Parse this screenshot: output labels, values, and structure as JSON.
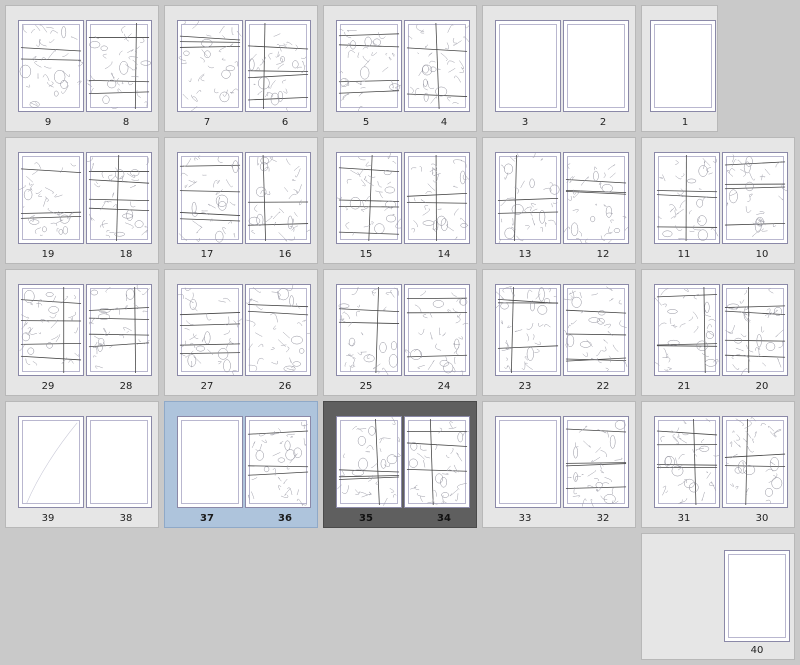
{
  "window": {
    "title": ""
  },
  "spreads": [
    {
      "pages": [
        "9",
        "8"
      ],
      "content": [
        "sketch",
        "sketch"
      ],
      "state": "normal"
    },
    {
      "pages": [
        "7",
        "6"
      ],
      "content": [
        "sketch",
        "sketch"
      ],
      "state": "normal"
    },
    {
      "pages": [
        "5",
        "4"
      ],
      "content": [
        "sketch",
        "sketch"
      ],
      "state": "normal"
    },
    {
      "pages": [
        "3",
        "2"
      ],
      "content": [
        "blank",
        "blank"
      ],
      "state": "normal"
    },
    {
      "pages": [
        "1"
      ],
      "content": [
        "blank"
      ],
      "state": "normal"
    },
    {
      "pages": [
        "19",
        "18"
      ],
      "content": [
        "sketch",
        "sketch"
      ],
      "state": "normal"
    },
    {
      "pages": [
        "17",
        "16"
      ],
      "content": [
        "sketch",
        "sketch"
      ],
      "state": "normal"
    },
    {
      "pages": [
        "15",
        "14"
      ],
      "content": [
        "sketch",
        "sketch"
      ],
      "state": "normal"
    },
    {
      "pages": [
        "13",
        "12"
      ],
      "content": [
        "sketch",
        "sketch"
      ],
      "state": "normal"
    },
    {
      "pages": [
        "11",
        "10"
      ],
      "content": [
        "sketch",
        "sketch"
      ],
      "state": "normal"
    },
    {
      "pages": [
        "29",
        "28"
      ],
      "content": [
        "sketch",
        "sketch"
      ],
      "state": "normal"
    },
    {
      "pages": [
        "27",
        "26"
      ],
      "content": [
        "sketch",
        "sketch"
      ],
      "state": "normal"
    },
    {
      "pages": [
        "25",
        "24"
      ],
      "content": [
        "sketch",
        "sketch"
      ],
      "state": "normal"
    },
    {
      "pages": [
        "23",
        "22"
      ],
      "content": [
        "sketch",
        "sketch"
      ],
      "state": "normal"
    },
    {
      "pages": [
        "21",
        "20"
      ],
      "content": [
        "sketch",
        "sketch"
      ],
      "state": "normal"
    },
    {
      "pages": [
        "39",
        "38"
      ],
      "content": [
        "faint",
        "blank"
      ],
      "state": "normal"
    },
    {
      "pages": [
        "37",
        "36"
      ],
      "content": [
        "blank",
        "sketch"
      ],
      "state": "selected"
    },
    {
      "pages": [
        "35",
        "34"
      ],
      "content": [
        "sketch",
        "sketch"
      ],
      "state": "active"
    },
    {
      "pages": [
        "33",
        "32"
      ],
      "content": [
        "blank",
        "sketch"
      ],
      "state": "normal"
    },
    {
      "pages": [
        "31",
        "30"
      ],
      "content": [
        "sketch",
        "sketch"
      ],
      "state": "normal"
    },
    {
      "pages": [
        "40"
      ],
      "content": [
        "blank"
      ],
      "state": "normal"
    }
  ],
  "colors": {
    "background": "#c9c9c9",
    "cell": "#e6e6e6",
    "selected": "#aec4dc",
    "active": "#5f5f5f",
    "page_border": "#8b89a8"
  }
}
